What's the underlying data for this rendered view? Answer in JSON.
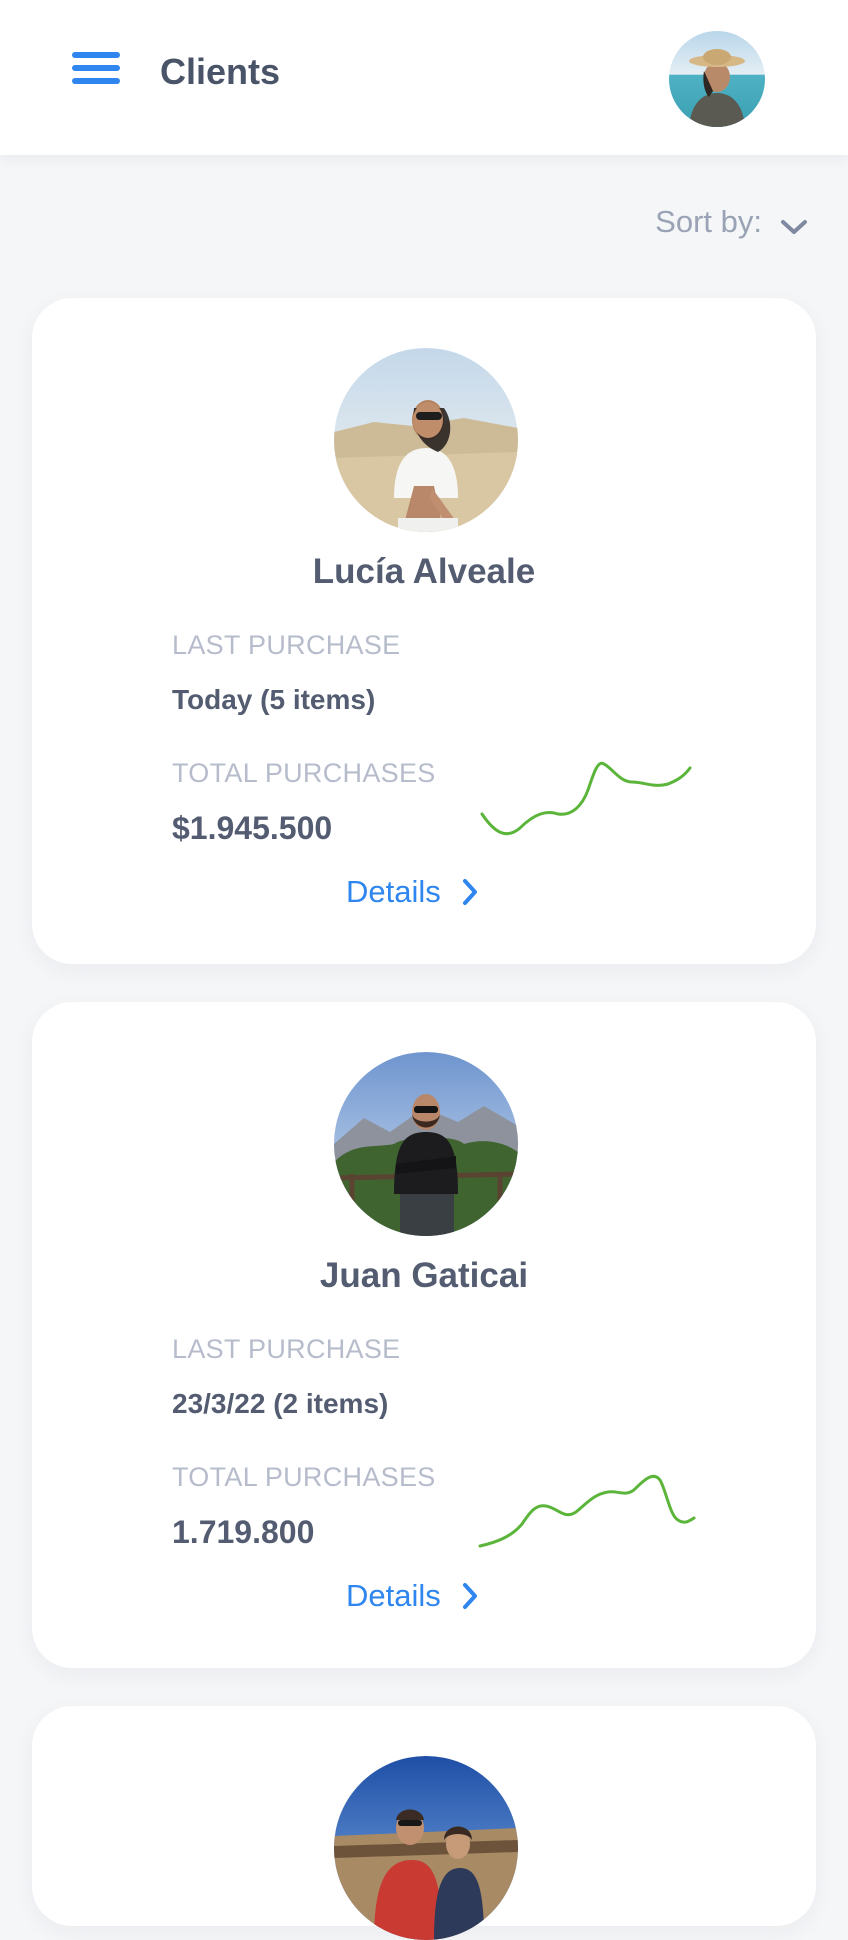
{
  "header": {
    "title": "Clients",
    "menu_icon": "hamburger-menu-icon",
    "avatar_icon": "user-avatar"
  },
  "sort": {
    "label": "Sort by:",
    "icon": "chevron-down-icon"
  },
  "clients": [
    {
      "name": "Lucía Alveale",
      "last_purchase_label": "LAST PURCHASE",
      "last_purchase": "Today (5 items)",
      "total_purchases_label": "TOTAL PURCHASES",
      "total_purchases": "$1.945.500",
      "details_label": "Details",
      "sparkline_color": "#5bb53a"
    },
    {
      "name": "Juan Gaticai",
      "last_purchase_label": "LAST PURCHASE",
      "last_purchase": "23/3/22 (2 items)",
      "total_purchases_label": "TOTAL PURCHASES",
      "total_purchases": "1.719.800",
      "details_label": "Details",
      "sparkline_color": "#5bb53a"
    }
  ],
  "colors": {
    "accent": "#2f86ee",
    "title_text": "#4a5468",
    "label_text": "#b6bccb",
    "background": "#f5f6f8"
  }
}
